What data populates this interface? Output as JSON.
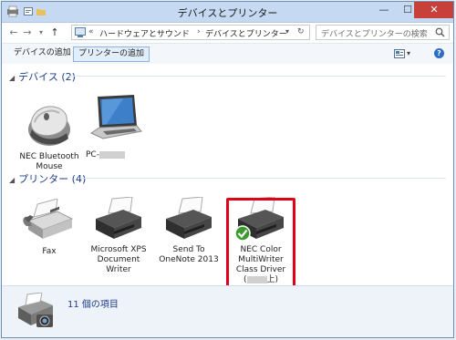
{
  "window": {
    "title": "デバイスとプリンター"
  },
  "titlebar": {
    "minimize": "—",
    "maximize": "☐",
    "close": "✕"
  },
  "nav": {
    "back": "←",
    "forward": "→",
    "dropdown": "▾",
    "up": "↑",
    "breadcrumb_sep": "«",
    "crumb1": "ハードウェアとサウンド",
    "crumb_arrow": "›",
    "crumb2": "デバイスとプリンター",
    "crumb_dropdown": "▾",
    "refresh": "↻"
  },
  "search": {
    "placeholder": "デバイスとプリンターの検索"
  },
  "toolbar": {
    "add_device": "デバイスの追加",
    "add_printer": "プリンターの追加",
    "help": "?"
  },
  "groups": {
    "devices": {
      "label": "デバイス (2)"
    },
    "printers": {
      "label": "プリンター (4)"
    }
  },
  "devices": [
    {
      "label": "NEC Bluetooth Mouse"
    },
    {
      "label": "PC-"
    }
  ],
  "printers": [
    {
      "label": "Fax"
    },
    {
      "label": "Microsoft XPS Document Writer"
    },
    {
      "label": "Send To OneNote 2013"
    },
    {
      "label_main": "NEC Color MultiWriter Class Driver",
      "label_paren_open": "(",
      "label_paren_close": "上)"
    }
  ],
  "details": {
    "count": "11 個の項目"
  },
  "colors": {
    "highlight": "#e1001a",
    "group_header": "#1e3d8a",
    "close_button": "#c7403a"
  }
}
